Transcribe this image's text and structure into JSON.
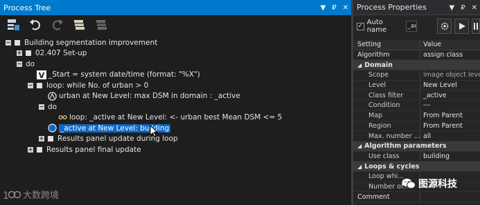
{
  "tree_panel": {
    "title": "Process Tree",
    "title_controls": [
      "▼",
      "₽",
      "✕"
    ],
    "nodes": [
      {
        "text": "Building segmentation improvement"
      },
      {
        "text": "02.407    Set-up"
      },
      {
        "text": "do"
      },
      {
        "text": "_Start = system date/time (format: \"%X\")"
      },
      {
        "text": "loop: while No. of urban > 0"
      },
      {
        "text": "urban at  New Level: max DSM in domain : _active"
      },
      {
        "text": "do"
      },
      {
        "text": "loop: _active at  New Level: <- urban best Mean DSM <= 5"
      },
      {
        "text": "_active at  New Level: building"
      },
      {
        "text": "Results panel update during loop"
      },
      {
        "text": "Results panel final update"
      }
    ],
    "watermark": "大数跨境"
  },
  "prop_panel": {
    "title": "Process Properties",
    "title_controls": [
      "▼",
      "₽",
      "✕"
    ],
    "auto_name_label": "Auto name",
    "name_value": "_ac",
    "header": {
      "setting": "Setting",
      "value": "Value"
    },
    "rows": [
      {
        "c1": "Algorithm",
        "c2": "assign class"
      },
      {
        "c1": "Domain",
        "c2": ""
      },
      {
        "c1": "Scope",
        "c2": "image object level"
      },
      {
        "c1": "Level",
        "c2": "New Level"
      },
      {
        "c1": "Class filter",
        "c2": "_active"
      },
      {
        "c1": "Condition",
        "c2": "---"
      },
      {
        "c1": "Map",
        "c2": "From Parent"
      },
      {
        "c1": "Region",
        "c2": "From Parent"
      },
      {
        "c1": "Max. number ...",
        "c2": "all"
      },
      {
        "c1": "Algorithm parameters",
        "c2": ""
      },
      {
        "c1": "Use class",
        "c2": "building"
      },
      {
        "c1": "Loops & cycles",
        "c2": ""
      },
      {
        "c1": "Loop whi...",
        "c2": ""
      },
      {
        "c1": "Number of...",
        "c2": ""
      },
      {
        "c1": "Comment",
        "c2": ""
      }
    ],
    "watermark": "图源科技"
  },
  "colors": {
    "accent": "#007acc",
    "selection": "#0e68c9",
    "background": "#1e1e1e"
  }
}
